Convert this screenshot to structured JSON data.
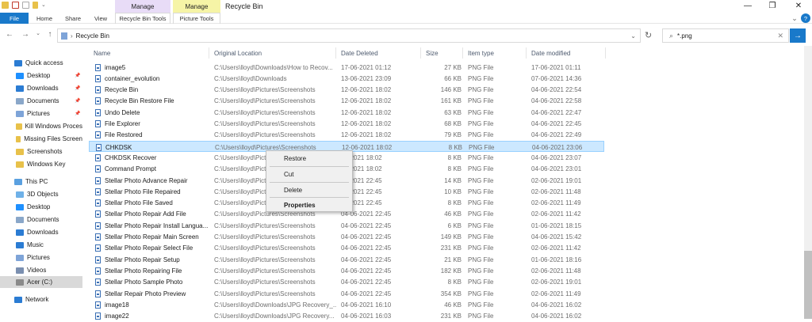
{
  "window": {
    "title": "Recycle Bin",
    "context_tabs": [
      "Manage",
      "Manage"
    ],
    "context_sub": [
      "Recycle Bin Tools",
      "Picture Tools"
    ],
    "ribbon_tabs": [
      "File",
      "Home",
      "Share",
      "View"
    ],
    "controls": [
      "—",
      "❐",
      "✕",
      "⌄",
      "?"
    ]
  },
  "address": {
    "path": "Recycle Bin",
    "search_value": "*.png",
    "nav_arrows": [
      "←",
      "→",
      "⌄",
      "↑"
    ]
  },
  "sidebar": {
    "items": [
      {
        "label": "Quick access",
        "icon": "star-icon"
      },
      {
        "label": "Desktop",
        "icon": "desktop-folder-icon",
        "pinned": true
      },
      {
        "label": "Downloads",
        "icon": "downloads-folder-icon",
        "pinned": true
      },
      {
        "label": "Documents",
        "icon": "documents-folder-icon",
        "pinned": true
      },
      {
        "label": "Pictures",
        "icon": "pictures-folder-icon",
        "pinned": true
      },
      {
        "label": "Kill Windows Proces",
        "icon": "folder-icon"
      },
      {
        "label": "Missing Files Screen",
        "icon": "folder-icon"
      },
      {
        "label": "Screenshots",
        "icon": "folder-icon"
      },
      {
        "label": "Windows Key",
        "icon": "folder-icon"
      },
      {
        "label": "This PC",
        "icon": "computer-icon"
      },
      {
        "label": "3D Objects",
        "icon": "3d-objects-icon"
      },
      {
        "label": "Desktop",
        "icon": "desktop-folder-icon"
      },
      {
        "label": "Documents",
        "icon": "documents-folder-icon"
      },
      {
        "label": "Downloads",
        "icon": "downloads-folder-icon"
      },
      {
        "label": "Music",
        "icon": "music-icon"
      },
      {
        "label": "Pictures",
        "icon": "pictures-folder-icon"
      },
      {
        "label": "Videos",
        "icon": "videos-icon"
      },
      {
        "label": "Acer (C:)",
        "icon": "drive-icon"
      },
      {
        "label": "Network",
        "icon": "network-icon"
      }
    ]
  },
  "columns": [
    "Name",
    "Original Location",
    "Date Deleted",
    "Size",
    "Item type",
    "Date modified"
  ],
  "files": [
    {
      "name": "image5",
      "loc": "C:\\Users\\lloyd\\Downloads\\How to Recov...",
      "deleted": "17-06-2021 01:12",
      "size": "27 KB",
      "type": "PNG File",
      "modified": "17-06-2021 01:11"
    },
    {
      "name": "container_evolution",
      "loc": "C:\\Users\\lloyd\\Downloads",
      "deleted": "13-06-2021 23:09",
      "size": "66 KB",
      "type": "PNG File",
      "modified": "07-06-2021 14:36"
    },
    {
      "name": "Recycle Bin",
      "loc": "C:\\Users\\lloyd\\Pictures\\Screenshots",
      "deleted": "12-06-2021 18:02",
      "size": "146 KB",
      "type": "PNG File",
      "modified": "04-06-2021 22:54"
    },
    {
      "name": "Recycle Bin Restore File",
      "loc": "C:\\Users\\lloyd\\Pictures\\Screenshots",
      "deleted": "12-06-2021 18:02",
      "size": "161 KB",
      "type": "PNG File",
      "modified": "04-06-2021 22:58"
    },
    {
      "name": "Undo Delete",
      "loc": "C:\\Users\\lloyd\\Pictures\\Screenshots",
      "deleted": "12-06-2021 18:02",
      "size": "63 KB",
      "type": "PNG File",
      "modified": "04-06-2021 22:47"
    },
    {
      "name": "File Explorer",
      "loc": "C:\\Users\\lloyd\\Pictures\\Screenshots",
      "deleted": "12-06-2021 18:02",
      "size": "68 KB",
      "type": "PNG File",
      "modified": "04-06-2021 22:45"
    },
    {
      "name": "File Restored",
      "loc": "C:\\Users\\lloyd\\Pictures\\Screenshots",
      "deleted": "12-06-2021 18:02",
      "size": "79 KB",
      "type": "PNG File",
      "modified": "04-06-2021 22:49"
    },
    {
      "name": "CHKDSK",
      "loc": "C:\\Users\\lloyd\\Pictures\\Screenshots",
      "deleted": "12-06-2021 18:02",
      "size": "8 KB",
      "type": "PNG File",
      "modified": "04-06-2021 23:06",
      "selected": true
    },
    {
      "name": "CHKDSK Recover",
      "loc": "C:\\Users\\lloyd\\Pictu",
      "deleted": "06-2021 18:02",
      "size": "8 KB",
      "type": "PNG File",
      "modified": "04-06-2021 23:07"
    },
    {
      "name": "Command Prompt",
      "loc": "C:\\Users\\lloyd\\Pictu",
      "deleted": "06-2021 18:02",
      "size": "8 KB",
      "type": "PNG File",
      "modified": "04-06-2021 23:01"
    },
    {
      "name": "Stellar Photo Advance Repair",
      "loc": "C:\\Users\\lloyd\\Pictu",
      "deleted": "06-2021 22:45",
      "size": "14 KB",
      "type": "PNG File",
      "modified": "02-06-2021 19:01"
    },
    {
      "name": "Stellar Photo File Repaired",
      "loc": "C:\\Users\\lloyd\\Pictu",
      "deleted": "06-2021 22:45",
      "size": "10 KB",
      "type": "PNG File",
      "modified": "02-06-2021 11:48"
    },
    {
      "name": "Stellar Photo File Saved",
      "loc": "C:\\Users\\lloyd\\Pictu",
      "deleted": "06-2021 22:45",
      "size": "8 KB",
      "type": "PNG File",
      "modified": "02-06-2021 11:49"
    },
    {
      "name": "Stellar Photo Repair Add File",
      "loc": "C:\\Users\\lloyd\\Pictures\\Screenshots",
      "deleted": "04-06-2021 22:45",
      "size": "46 KB",
      "type": "PNG File",
      "modified": "02-06-2021 11:42"
    },
    {
      "name": "Stellar Photo Repair Install Langua...",
      "loc": "C:\\Users\\lloyd\\Pictures\\Screenshots",
      "deleted": "04-06-2021 22:45",
      "size": "6 KB",
      "type": "PNG File",
      "modified": "01-06-2021 18:15"
    },
    {
      "name": "Stellar Photo Repair Main Screen",
      "loc": "C:\\Users\\lloyd\\Pictures\\Screenshots",
      "deleted": "04-06-2021 22:45",
      "size": "149 KB",
      "type": "PNG File",
      "modified": "04-06-2021 15:42"
    },
    {
      "name": "Stellar Photo Repair Select File",
      "loc": "C:\\Users\\lloyd\\Pictures\\Screenshots",
      "deleted": "04-06-2021 22:45",
      "size": "231 KB",
      "type": "PNG File",
      "modified": "02-06-2021 11:42"
    },
    {
      "name": "Stellar Photo Repair Setup",
      "loc": "C:\\Users\\lloyd\\Pictures\\Screenshots",
      "deleted": "04-06-2021 22:45",
      "size": "21 KB",
      "type": "PNG File",
      "modified": "01-06-2021 18:16"
    },
    {
      "name": "Stellar Photo Repairing File",
      "loc": "C:\\Users\\lloyd\\Pictures\\Screenshots",
      "deleted": "04-06-2021 22:45",
      "size": "182 KB",
      "type": "PNG File",
      "modified": "02-06-2021 11:48"
    },
    {
      "name": "Stellar Photo Sample Photo",
      "loc": "C:\\Users\\lloyd\\Pictures\\Screenshots",
      "deleted": "04-06-2021 22:45",
      "size": "8 KB",
      "type": "PNG File",
      "modified": "02-06-2021 19:01"
    },
    {
      "name": "Stellar Repair Photo Preview",
      "loc": "C:\\Users\\lloyd\\Pictures\\Screenshots",
      "deleted": "04-06-2021 22:45",
      "size": "354 KB",
      "type": "PNG File",
      "modified": "02-06-2021 11:49"
    },
    {
      "name": "image18",
      "loc": "C:\\Users\\lloyd\\Downloads\\JPG Recovery_...",
      "deleted": "04-06-2021 16:10",
      "size": "46 KB",
      "type": "PNG File",
      "modified": "04-06-2021 16:02"
    },
    {
      "name": "image22",
      "loc": "C:\\Users\\lloyd\\Downloads\\JPG Recovery...",
      "deleted": "04-06-2021 16:03",
      "size": "231 KB",
      "type": "PNG File",
      "modified": "04-06-2021 16:02"
    }
  ],
  "context_menu": {
    "items": [
      "Restore",
      "Cut",
      "Delete",
      "Properties"
    ]
  },
  "colors": {
    "accent": "#1979ca",
    "selection": "#cce8ff",
    "manage_tab_1": "#e8dcf7",
    "manage_tab_2": "#f6f4a6"
  }
}
